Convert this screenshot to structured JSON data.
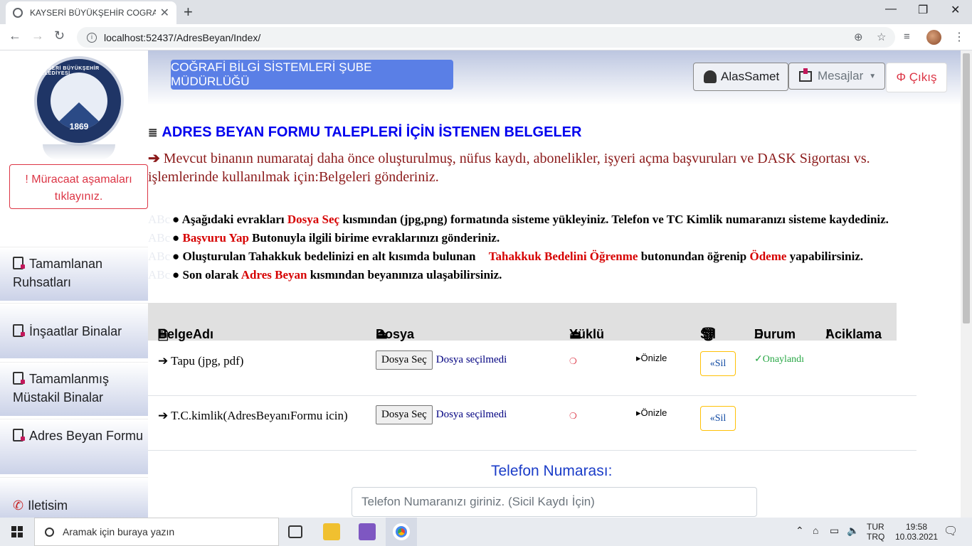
{
  "browser": {
    "tab_title": "KAYSERİ BÜYÜKŞEHİR COGRAFİ B",
    "url": "localhost:52437/AdresBeyan/Index/"
  },
  "sidebar": {
    "logo_ring": "KAYSERİ BÜYÜKŞEHİR BELEDİYESİ",
    "logo_year": "1869",
    "alert": "! Müracaat aşamaları tıklayınız.",
    "items": [
      {
        "label": "Tamamlanan Ruhsatları"
      },
      {
        "label": "İnşaatlar Binalar"
      },
      {
        "label": "Tamamlanmış Müstakil Binalar"
      },
      {
        "label": "Adres Beyan Formu"
      },
      {
        "label": "Iletisim"
      }
    ]
  },
  "header": {
    "title_button": "COĞRAFİ BİLGİ SİSTEMLERİ ŞUBE MÜDÜRLÜĞÜ",
    "user": "AlasSamet",
    "messages": "Mesajlar",
    "logout": "Φ Çıkış"
  },
  "content": {
    "heading": "ADRES BEYAN FORMU TALEPLERİ İÇİN İSTENEN BELGELER",
    "intro": "Mevcut binanın numarataj daha önce oluşturulmuş, nüfus kaydı, abonelikler, işyeri açma başvuruları ve DASK Sigortası vs. işlemlerinde kullanılmak için:Belgeleri gönderiniz.",
    "rules": [
      {
        "pre": "● Aşağıdaki evrakları ",
        "red": "Dosya Seç",
        "post": " kısmından (jpg,png) formatında sisteme yükleyiniz. Telefon ve TC Kimlik numaranızı sisteme kaydediniz."
      },
      {
        "pre": "● ",
        "red": "Başvuru Yap",
        "post": " Butonuyla ilgili birime evraklarınızı gönderiniz."
      },
      {
        "pre": "● Oluşturulan Tahakkuk bedelinizi en alt kısımda bulunan ",
        "red": "Tahakkuk Bedelini Öğrenme",
        "post": " butonundan öğrenip ",
        "red2": "Ödeme",
        "post2": " yapabilirsiniz."
      },
      {
        "pre": "● Son olarak ",
        "red": "Adres Beyan",
        "post": " kısmından beyanınıza ulaşabilirsiniz."
      }
    ]
  },
  "table": {
    "headers": {
      "name": "BelgeAdı",
      "file": "Dosya",
      "uploaded": "Yüklü",
      "delete": "Sil",
      "status": "Durum",
      "note": "Aciklama"
    },
    "rows": [
      {
        "name": "➔ Tapu (jpg, pdf)",
        "file_button": "Dosya Seç",
        "file_status": "Dosya seçilmedi",
        "preview": "Önizle",
        "delete": "«Sil",
        "status": "✓Onaylandı"
      },
      {
        "name": "➔ T.C.kimlik(AdresBeyanıFormu icin)",
        "file_button": "Dosya Seç",
        "file_status": "Dosya seçilmedi",
        "preview": "Önizle",
        "delete": "«Sil",
        "status": ""
      }
    ]
  },
  "phone": {
    "label": "Telefon Numarası:",
    "placeholder": "Telefon Numaranızı giriniz. (Sicil Kaydı İçin)"
  },
  "taskbar": {
    "search_placeholder": "Aramak için buraya yazın",
    "lang1": "TUR",
    "lang2": "TRQ",
    "time": "19:58",
    "date": "10.03.2021"
  }
}
